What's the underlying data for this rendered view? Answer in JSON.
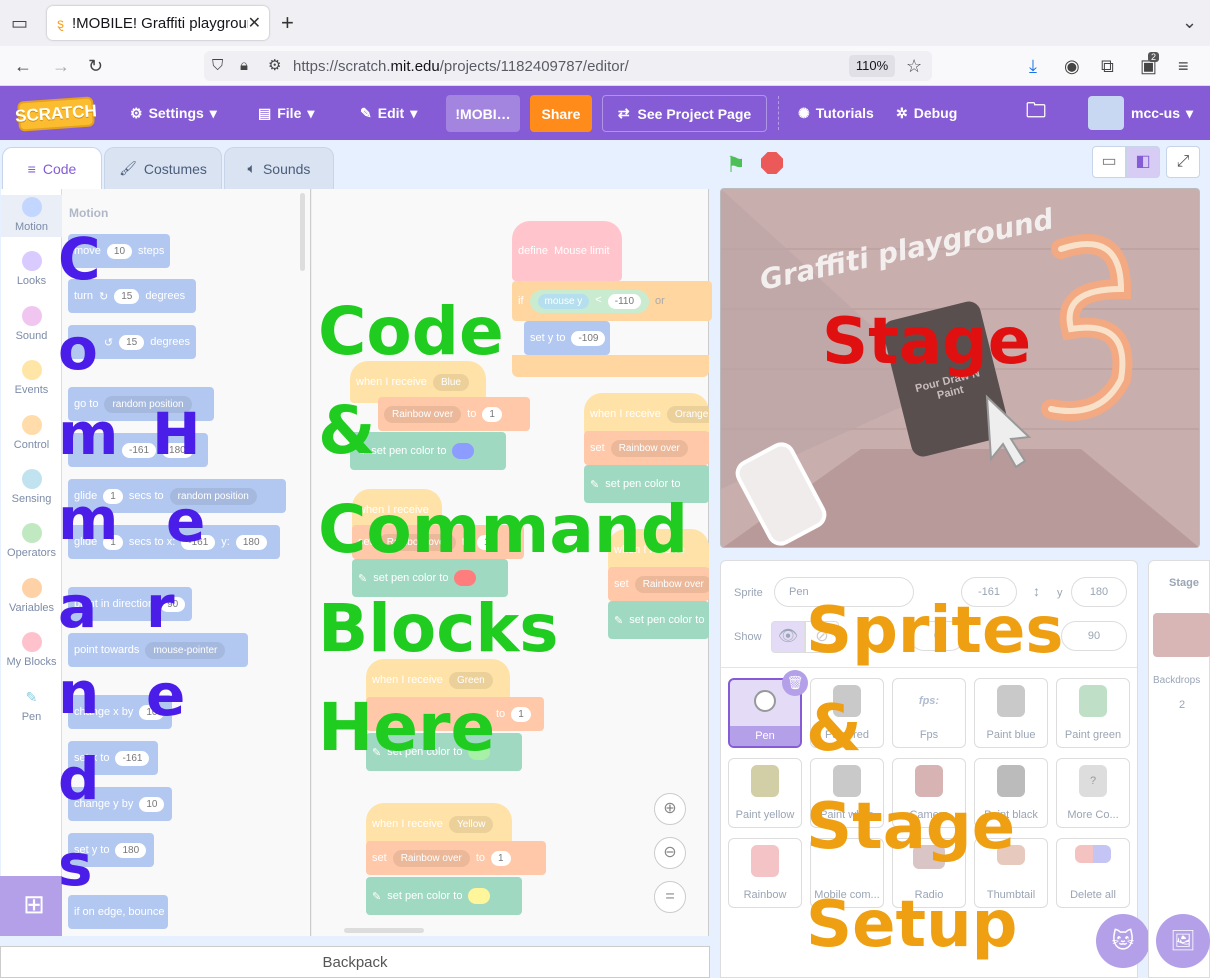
{
  "browser": {
    "tab_title": "!MOBILE! Graffiti playground",
    "new_tab": "+",
    "url_prefix": "https://scratch.",
    "url_domain": "mit.edu",
    "url_path": "/projects/1182409787/editor/",
    "zoom": "110%",
    "notif_count": "2"
  },
  "menu": {
    "logo": "SCRATCH",
    "settings": "Settings",
    "file": "File",
    "edit": "Edit",
    "project_title": "!MOBI…",
    "share": "Share",
    "see_project": "See Project Page",
    "tutorials": "Tutorials",
    "debug": "Debug",
    "username": "mcc-us"
  },
  "tabs": {
    "code": "Code",
    "costumes": "Costumes",
    "sounds": "Sounds"
  },
  "categories": [
    {
      "label": "Motion",
      "color": "#4c97ff"
    },
    {
      "label": "Looks",
      "color": "#9966ff"
    },
    {
      "label": "Sound",
      "color": "#cf63cf"
    },
    {
      "label": "Events",
      "color": "#ffbf00"
    },
    {
      "label": "Control",
      "color": "#ffab19"
    },
    {
      "label": "Sensing",
      "color": "#5cb1d6"
    },
    {
      "label": "Operators",
      "color": "#59c059"
    },
    {
      "label": "Variables",
      "color": "#ff8c1a"
    },
    {
      "label": "My Blocks",
      "color": "#ff6680"
    },
    {
      "label": "Pen",
      "color": "#0fbd8c"
    }
  ],
  "palette": {
    "heading": "Motion",
    "move": "move",
    "move_val": "10",
    "steps": "steps",
    "turn": "turn",
    "turn_val": "15",
    "degrees": "degrees",
    "turn2_val": "15",
    "degrees2": "degrees",
    "goto": "go to",
    "goto_opt": "random position",
    "gotoxy_x": "-161",
    "gotoxy_y": "180",
    "glide": "glide",
    "glide_val": "1",
    "secs_to": "secs to",
    "glide_opt": "random position",
    "glide2": "glide",
    "glide2_val": "1",
    "secs_to_x": "secs to x:",
    "glide2_x": "-161",
    "y_label": "y:",
    "glide2_y": "180",
    "point_dir": "point in direction",
    "point_dir_val": "90",
    "point_towards": "point towards",
    "point_towards_opt": "mouse-pointer",
    "change_x": "change x by",
    "change_x_val": "10",
    "set_x": "set x to",
    "set_x_val": "-161",
    "change_y": "change y by",
    "change_y_val": "10",
    "set_y": "set y to",
    "set_y_val": "180",
    "bounce": "if on edge, bounce"
  },
  "workspace": {
    "define": "define",
    "define_name": "Mouse limit",
    "if": "if",
    "mouse_y": "mouse y",
    "lt": "<",
    "if_val": "-110",
    "or": "or",
    "set_y": "set y to",
    "set_y_val": "-109",
    "recv1": "when I receive",
    "recv1_opt": "Blue",
    "set1": "Rainbow over",
    "to": "to",
    "set1_val": "1",
    "pencolor": "set pen color to",
    "recv2": "when I receive",
    "recv2_opt": "Orange",
    "set_label": "set",
    "set2": "Rainbow over",
    "recv3": "when I receive",
    "set3": "Rainbow over",
    "set3_val": "1",
    "recv4": "when I receive",
    "recv4_opt": "Green",
    "set4_val": "1",
    "recv5": "when I receive",
    "recv5_opt": "Yellow",
    "set5": "Rainbow over",
    "set5_val": "1",
    "pen_color_blue": "#8c9cff",
    "pen_color_red": "#ff7d7d",
    "pen_color_green": "#a8f0a8",
    "pen_color_yellow": "#fff59a"
  },
  "backpack": "Backpack",
  "stage": {
    "title_text": "Graffiti playground",
    "sign_text": "Pour Draw N Paint"
  },
  "sprite_info": {
    "sprite_label": "Sprite",
    "sprite_name": "Pen",
    "x_val": "-161",
    "y_label": "y",
    "y_val": "180",
    "show_label": "Show",
    "size_val": "0",
    "direction_val": "90"
  },
  "sprites": [
    {
      "name": "Pen",
      "selected": true
    },
    {
      "name": "Paint red"
    },
    {
      "name": "Fps"
    },
    {
      "name": "Paint blue"
    },
    {
      "name": "Paint green"
    },
    {
      "name": "Paint yellow"
    },
    {
      "name": "Paint white"
    },
    {
      "name": "Camera"
    },
    {
      "name": "Paint black"
    },
    {
      "name": "More Co..."
    },
    {
      "name": "Rainbow"
    },
    {
      "name": "Mobile com..."
    },
    {
      "name": "Radio"
    },
    {
      "name": "Thumbtail"
    },
    {
      "name": "Delete all"
    }
  ],
  "stage_panel": {
    "label": "Stage",
    "backdrops_label": "Backdrops",
    "backdrops_count": "2"
  },
  "overlays": {
    "commands": [
      "C",
      "o",
      "m",
      "m",
      "a",
      "n",
      "d",
      "s"
    ],
    "here": [
      "H",
      "e",
      "r",
      "e"
    ],
    "code_lines": [
      "Code",
      "&",
      "Command",
      "Blocks",
      "Here"
    ],
    "stage": "Stage",
    "sprites_lines": [
      "Sprites",
      "&",
      "Stage",
      "Setup"
    ]
  }
}
